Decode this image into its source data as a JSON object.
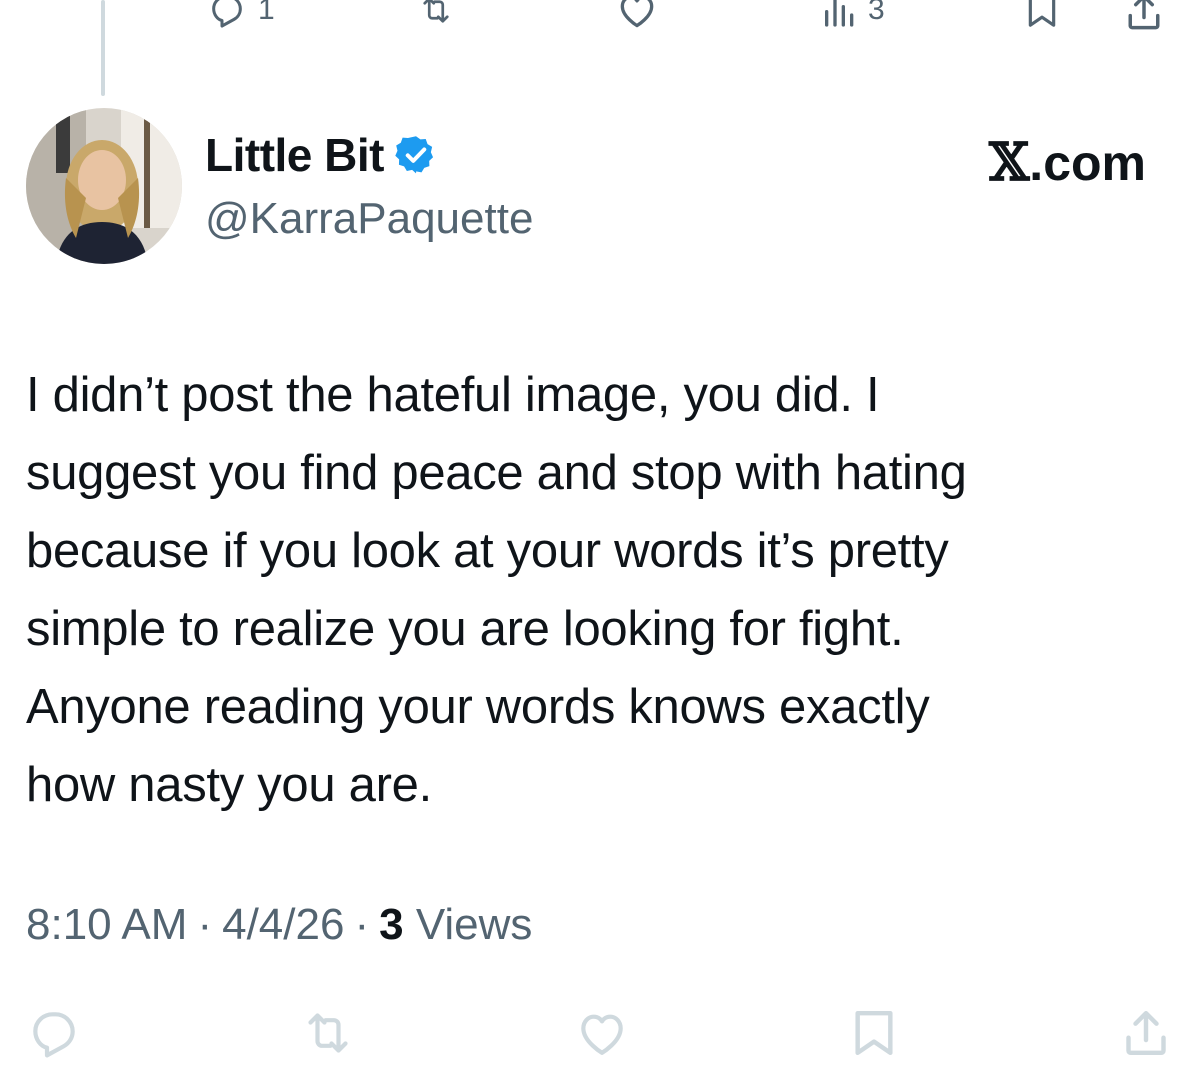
{
  "previous_tweet_actions": {
    "reply_count": "1",
    "views_count": "3"
  },
  "tweet": {
    "author": {
      "display_name": "Little Bit",
      "handle": "@KarraPaquette",
      "verified": true
    },
    "brand": {
      "x_glyph": "𝕏",
      "suffix": ".com"
    },
    "text": "I didn’t post the hateful image, you did. I\nsuggest you find peace and stop with hating\nbecause if you look at your words it’s pretty\nsimple to realize you are looking for fight.\nAnyone reading your words knows exactly\nhow nasty you are.",
    "time": "8:10 AM",
    "separator": "·",
    "date": "4/4/26",
    "views_count": "3",
    "views_label": "Views"
  },
  "colors": {
    "text": "#0f1419",
    "secondary": "#536471",
    "icon_light": "#cfd9de",
    "verified": "#1d9bf0"
  },
  "icons": [
    "reply-icon",
    "retweet-icon",
    "like-icon",
    "views-icon",
    "bookmark-icon",
    "share-icon",
    "verified-badge-icon"
  ]
}
